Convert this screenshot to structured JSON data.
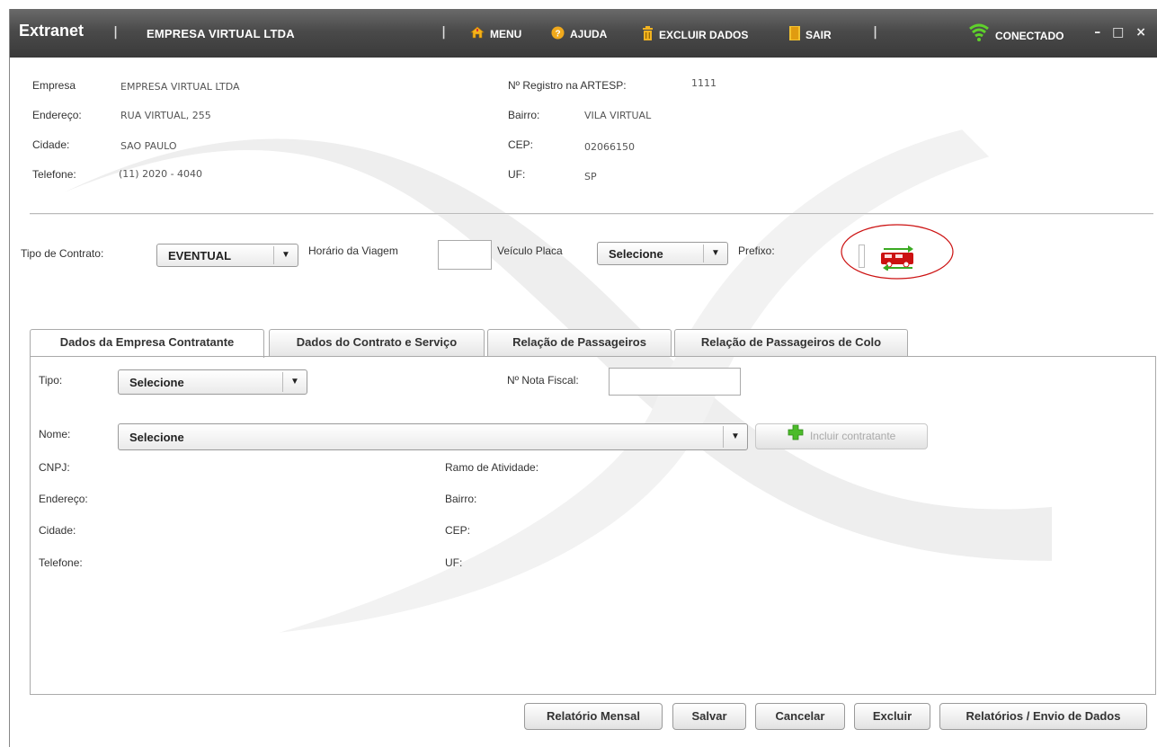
{
  "titlebar": {
    "app_name": "Extranet",
    "separator": "|",
    "company": "EMPRESA VIRTUAL LTDA",
    "menu": "MENU",
    "help": "AJUDA",
    "delete_data": "EXCLUIR DADOS",
    "exit": "SAIR",
    "status": "CONECTADO",
    "window_controls": "– □ ×"
  },
  "company_info": {
    "empresa_label": "Empresa",
    "empresa_value": "EMPRESA VIRTUAL LTDA",
    "endereco_label": "Endereço:",
    "endereco_value": "RUA VIRTUAL, 255",
    "cidade_label": "Cidade:",
    "cidade_value": "SAO PAULO",
    "telefone_label": "Telefone:",
    "telefone_value": "(11) 2020 - 4040",
    "registro_label": "Nº Registro na ARTESP:",
    "registro_value": "1111",
    "bairro_label": "Bairro:",
    "bairro_value": "VILA VIRTUAL",
    "cep_label": "CEP:",
    "cep_value": "02066150",
    "uf_label": "UF:",
    "uf_value": "SP"
  },
  "contract": {
    "tipo_label": "Tipo de Contrato:",
    "tipo_value": "EVENTUAL",
    "horario_label": "Horário da Viagem",
    "horario_value": "",
    "veiculo_label": "Veículo Placa",
    "veiculo_value": "Selecione",
    "prefixo_label": "Prefixo:"
  },
  "tabs": [
    {
      "label": "Dados da Empresa Contratante",
      "active": true
    },
    {
      "label": "Dados do Contrato e Serviço",
      "active": false
    },
    {
      "label": "Relação de Passageiros",
      "active": false
    },
    {
      "label": "Relação de Passageiros de Colo",
      "active": false
    }
  ],
  "form": {
    "tipo_label": "Tipo:",
    "tipo_value": "Selecione",
    "nota_label": "Nº Nota Fiscal:",
    "nota_value": "",
    "nome_label": "Nome:",
    "nome_value": "Selecione",
    "incluir_label": "Incluir contratante",
    "cnpj_label": "CNPJ:",
    "ramo_label": "Ramo de Atividade:",
    "endereco_label": "Endereço:",
    "bairro_label": "Bairro:",
    "cidade_label": "Cidade:",
    "cep_label": "CEP:",
    "telefone_label": "Telefone:",
    "uf_label": "UF:"
  },
  "actions": {
    "relatorio_mensal": "Relatório Mensal",
    "salvar": "Salvar",
    "cancelar": "Cancelar",
    "excluir": "Excluir",
    "relatorios_envio": "Relatórios / Envio de Dados"
  },
  "colors": {
    "titlebar": "#4a4a4a",
    "accent_red": "#cc1111",
    "accent_green": "#3aaa22",
    "wifi_green": "#5fd12b"
  }
}
